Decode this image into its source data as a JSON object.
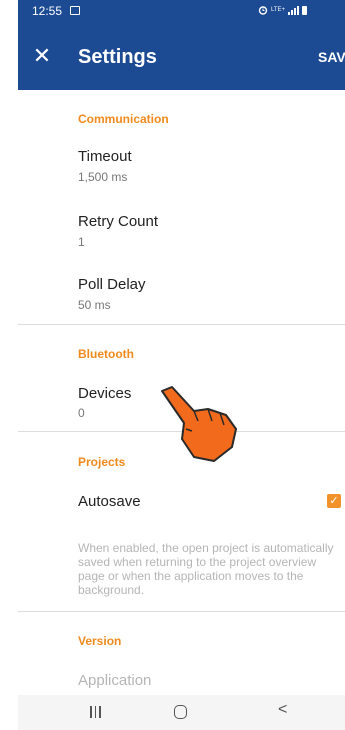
{
  "status_bar": {
    "time": "12:55",
    "gallery_icon": "image-icon",
    "right_icons": [
      "alarm-icon",
      "lte-icon",
      "signal-icon",
      "battery-icon"
    ],
    "lte_label": "LTE+"
  },
  "app_bar": {
    "close_icon": "close-icon",
    "title": "Settings",
    "save_label": "SAV"
  },
  "sections": {
    "communication": {
      "header": "Communication",
      "items": [
        {
          "title": "Timeout",
          "value": "1,500 ms"
        },
        {
          "title": "Retry Count",
          "value": "1"
        },
        {
          "title": "Poll Delay",
          "value": "50 ms"
        }
      ]
    },
    "bluetooth": {
      "header": "Bluetooth",
      "items": [
        {
          "title": "Devices",
          "value": "0"
        }
      ]
    },
    "projects": {
      "header": "Projects",
      "autosave": {
        "title": "Autosave",
        "checked": true,
        "description": "When enabled, the open project is automatically saved when returning to the project overview page or when the application moves to the background."
      }
    },
    "version": {
      "header": "Version",
      "items": [
        {
          "title": "Application"
        }
      ]
    }
  },
  "nav_bar": {
    "recent_icon": "recent-apps-icon",
    "home_icon": "home-icon",
    "back_icon": "back-icon"
  },
  "colors": {
    "primary": "#1c4a93",
    "accent": "#f08a1c",
    "hand": "#f26a1b"
  }
}
